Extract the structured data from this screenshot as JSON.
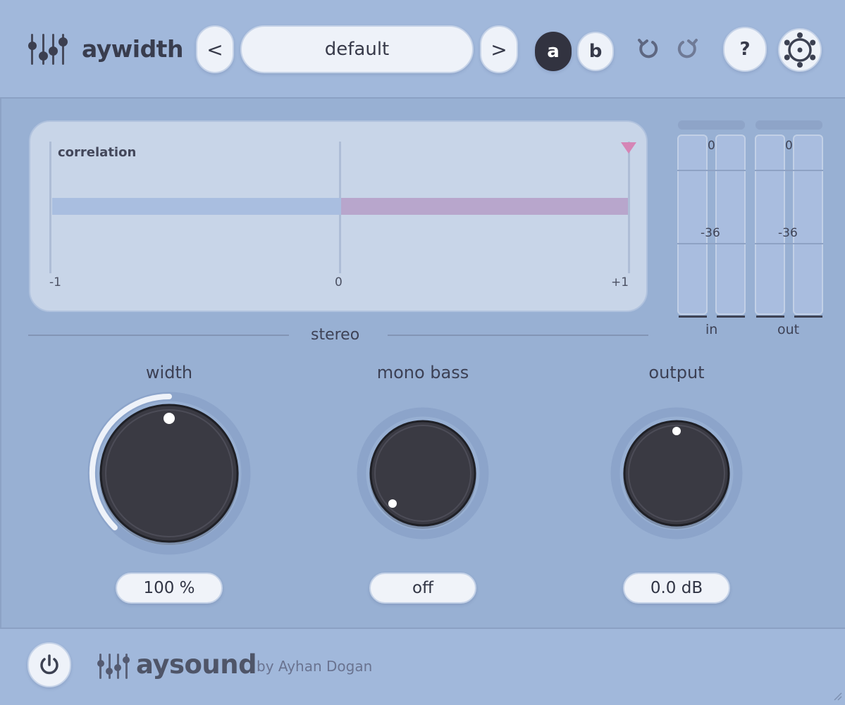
{
  "header": {
    "app_title": "aywidth",
    "prev_label": "<",
    "next_label": ">",
    "preset_name": "default",
    "ab_a_label": "a",
    "ab_b_label": "b",
    "help_label": "?",
    "icons": [
      "sliders-logo-icon",
      "undo-icon",
      "redo-icon",
      "settings-icon"
    ]
  },
  "correlation": {
    "title": "correlation",
    "ticks": [
      "-1",
      "0",
      "+1"
    ],
    "value": 1
  },
  "section": {
    "label": "stereo"
  },
  "meters": {
    "in": {
      "label": "in",
      "top_value": "0",
      "mid_value": "-36"
    },
    "out": {
      "label": "out",
      "top_value": "0",
      "mid_value": "-36"
    }
  },
  "knobs": {
    "width": {
      "label": "width",
      "value": "100 %"
    },
    "mono_bass": {
      "label": "mono bass",
      "value": "off"
    },
    "output": {
      "label": "output",
      "value": "0.0 dB"
    }
  },
  "footer": {
    "brand": "aysound",
    "credit": "by Ayhan Dogan",
    "icons": [
      "power-icon",
      "sliders-logo-icon",
      "resize-grip-icon"
    ]
  },
  "colors": {
    "background": "#98b0d3",
    "panel": "#c8d5e8",
    "knob": "#3a3a44",
    "accent_pink": "#d585b6",
    "selected_button": "#323340"
  }
}
